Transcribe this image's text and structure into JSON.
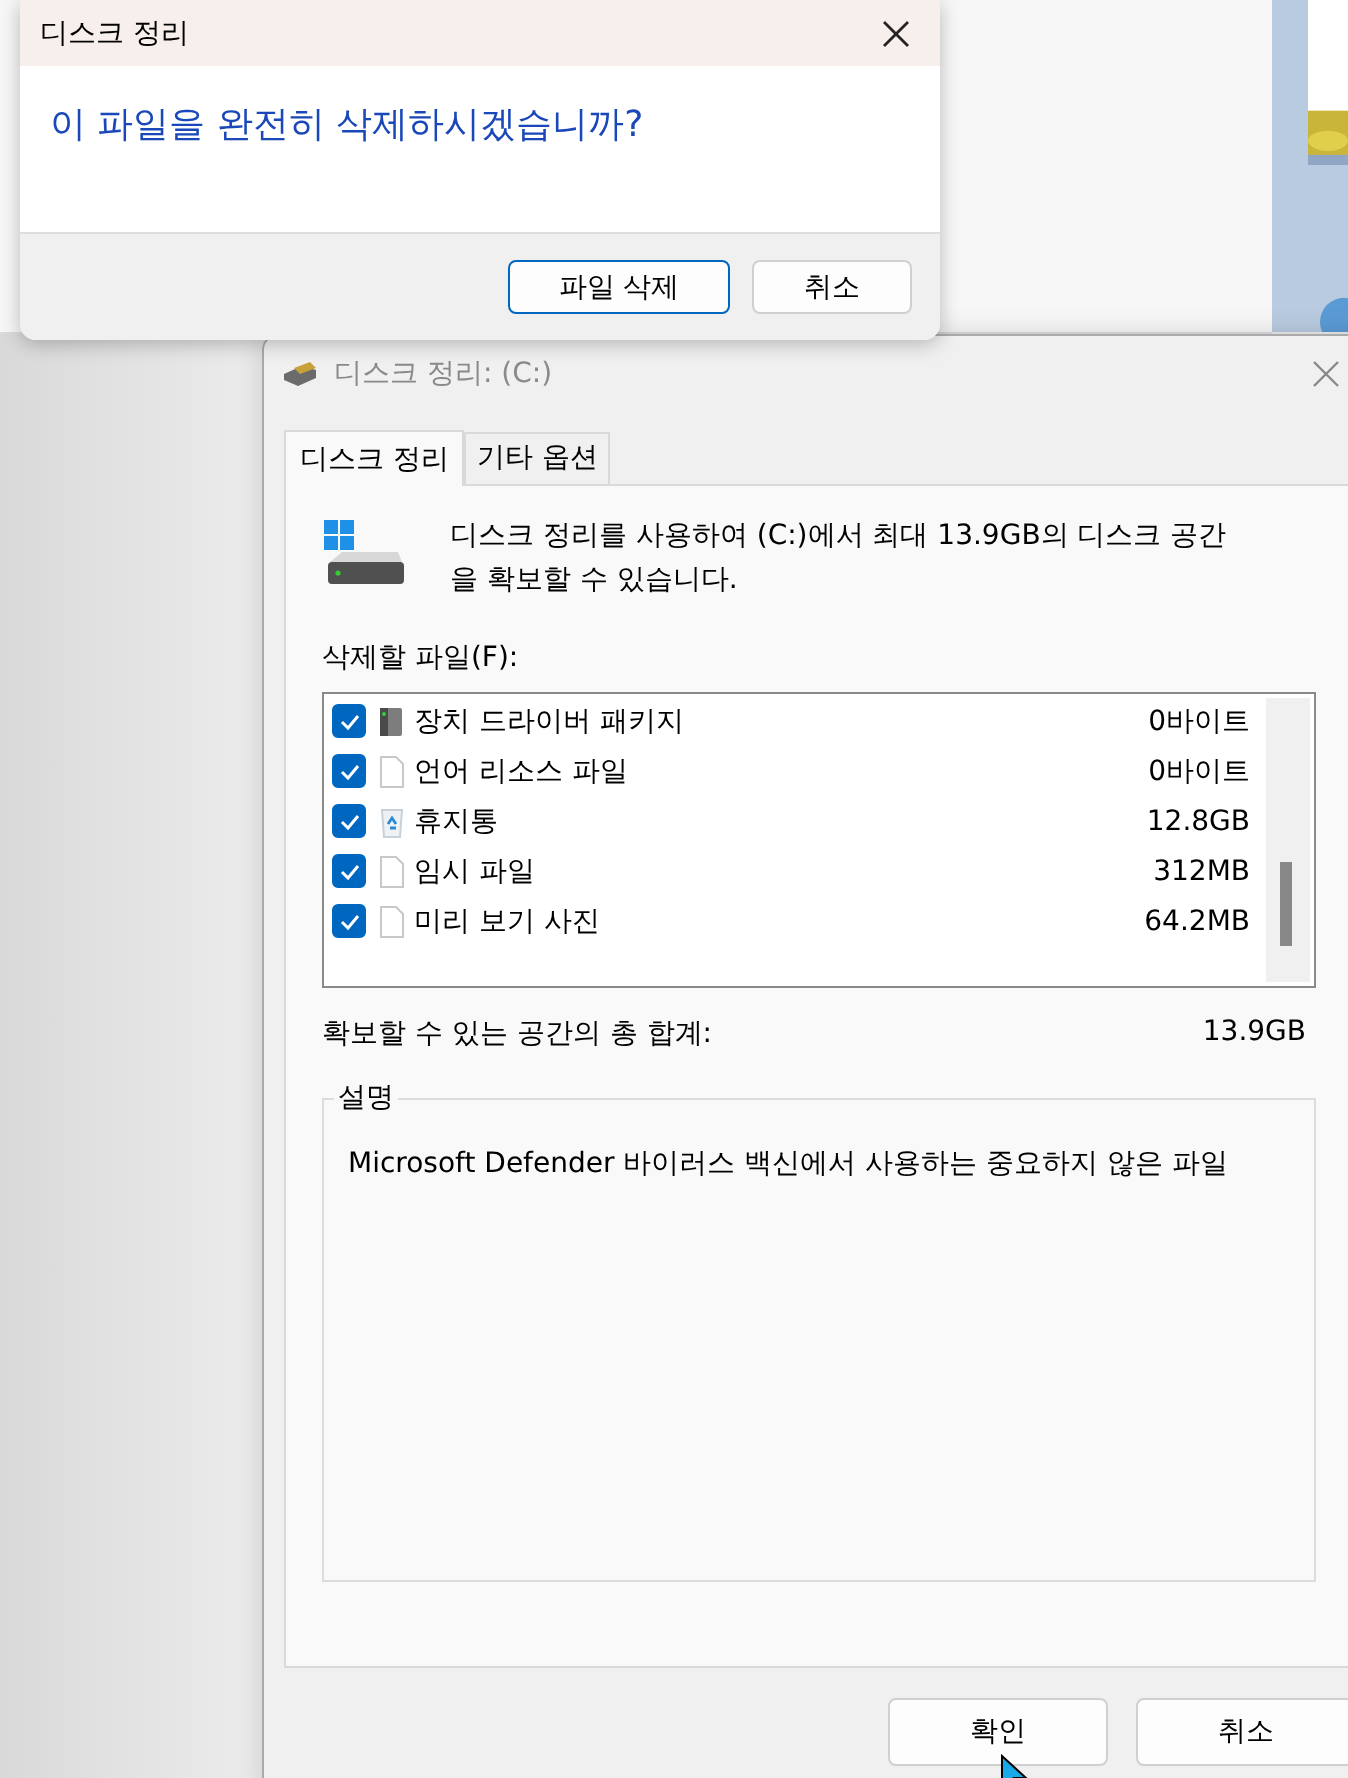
{
  "dialog": {
    "title": "디스크 정리",
    "message": "이 파일을 완전히 삭제하시겠습니까?",
    "buttons": [
      {
        "label": "파일 삭제",
        "default": true
      },
      {
        "label": "취소",
        "default": false
      }
    ]
  },
  "window": {
    "title": "디스크 정리: (C:)"
  },
  "tabs": [
    {
      "label": "디스크 정리",
      "selected": true
    },
    {
      "label": "기타 옵션",
      "selected": false
    }
  ],
  "intro": "디스크 정리를 사용하여 (C:)에서 최대 13.9GB의 디스크 공간을 확보할 수 있습니다.",
  "files_label": "삭제할 파일(F):",
  "files": [
    {
      "kind": "driver",
      "name": "장치 드라이버 패키지",
      "size": "0바이트",
      "checked": true
    },
    {
      "kind": "file",
      "name": "언어 리소스 파일",
      "size": "0바이트",
      "checked": true
    },
    {
      "kind": "recycle",
      "name": "휴지통",
      "size": "12.8GB",
      "checked": true
    },
    {
      "kind": "file",
      "name": "임시 파일",
      "size": "312MB",
      "checked": true
    },
    {
      "kind": "file",
      "name": "미리 보기 사진",
      "size": "64.2MB",
      "checked": true
    }
  ],
  "total_label": "확보할 수 있는 공간의 총 합계:",
  "total": "13.9GB",
  "description": {
    "legend": "설명",
    "text": "Microsoft Defender 바이러스 백신에서 사용하는 중요하지 않은 파일"
  },
  "buttons": [
    {
      "label": "확인",
      "default": false
    },
    {
      "label": "취소",
      "default": false
    }
  ]
}
